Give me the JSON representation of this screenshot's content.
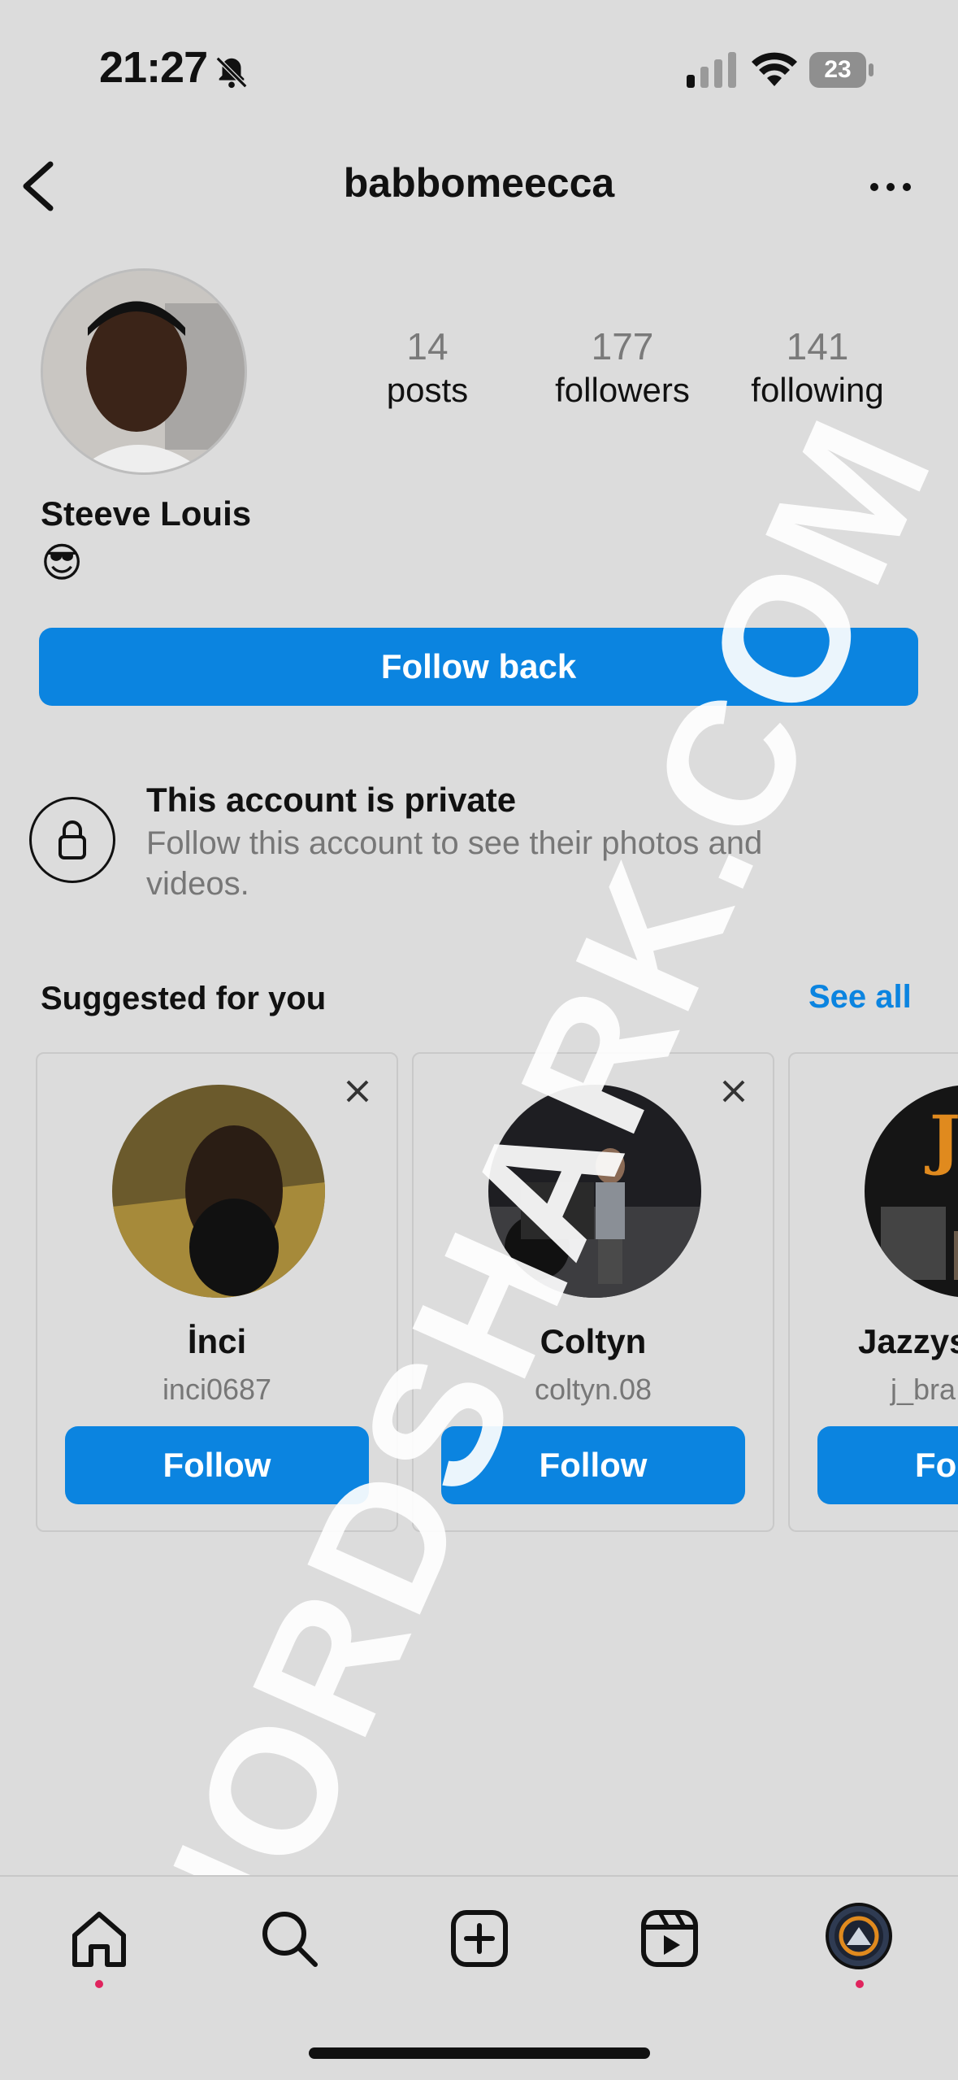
{
  "status_bar": {
    "time": "21:27",
    "battery": "23"
  },
  "header": {
    "username": "babbomeecca"
  },
  "profile": {
    "full_name": "Steeve Louis",
    "bio_emoji": "😎",
    "stats": [
      {
        "value": "14",
        "label": "posts"
      },
      {
        "value": "177",
        "label": "followers"
      },
      {
        "value": "141",
        "label": "following"
      }
    ],
    "follow_back_label": "Follow back"
  },
  "private": {
    "title": "This account is private",
    "subtitle": "Follow this account to see their photos and videos."
  },
  "suggestions": {
    "title": "Suggested for you",
    "see_all": "See all",
    "cards": [
      {
        "name": "İnci",
        "handle": "inci0687",
        "button": "Follow",
        "photo_color": "#5a4a2a"
      },
      {
        "name": "Coltyn",
        "handle": "coltyn.08",
        "button": "Follow",
        "photo_color": "#2c2c2c"
      },
      {
        "name": "Jazzys",
        "handle": "j_bra",
        "button": "Fo",
        "photo_color": "#1a1a1a"
      }
    ]
  },
  "tab_bar": {
    "icons": [
      "home-icon",
      "search-icon",
      "create-icon",
      "reels-icon",
      "profile-avatar"
    ]
  },
  "watermark": "NORDSHARK.COM",
  "colors": {
    "accent": "#0b84e0",
    "background": "#dcdcdc",
    "notification_dot": "#e0245e"
  }
}
